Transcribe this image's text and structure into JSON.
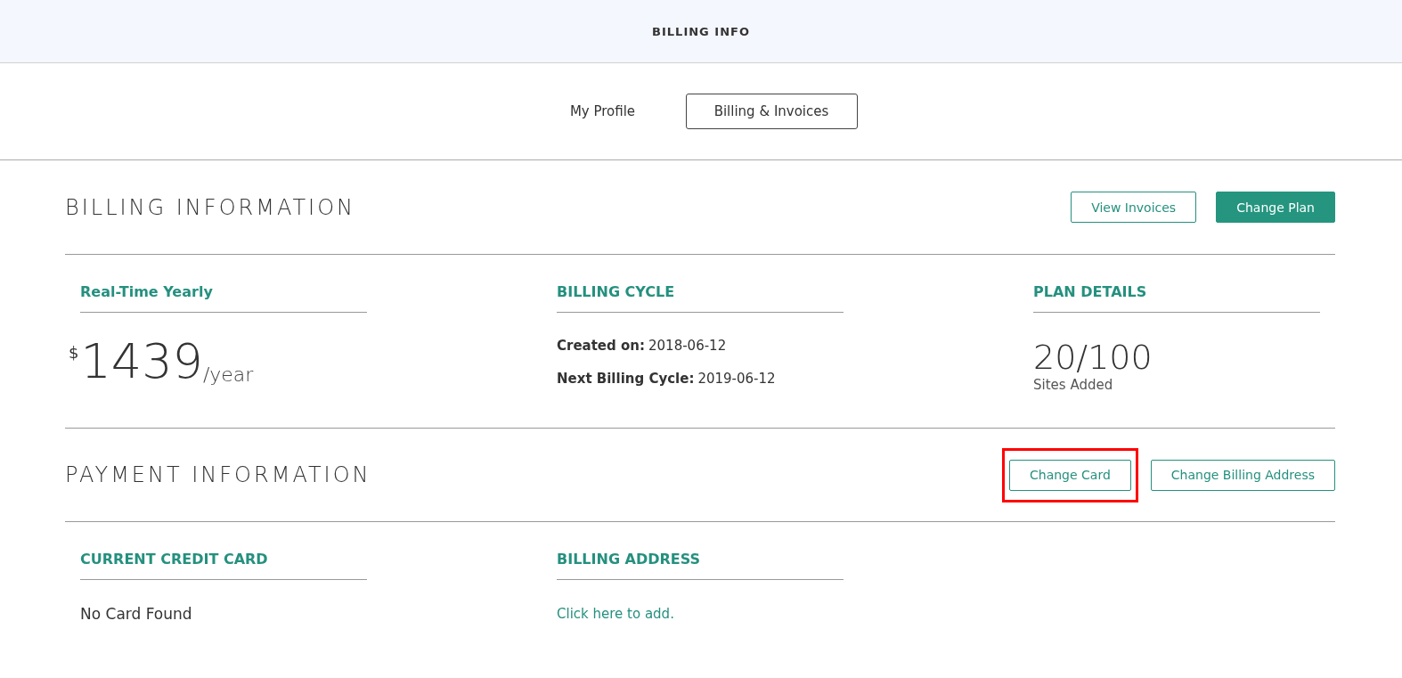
{
  "header": {
    "title": "BILLING INFO"
  },
  "tabs": [
    {
      "label": "My Profile",
      "selected": false
    },
    {
      "label": "Billing & Invoices",
      "selected": true
    }
  ],
  "sections": [
    {
      "title": "BILLING INFORMATION",
      "buttons": [
        {
          "label": "View Invoices",
          "kind": "outline",
          "highlighted": false
        },
        {
          "label": "Change Plan",
          "kind": "filled",
          "highlighted": false
        }
      ],
      "columns": [
        {
          "heading": "Real-Time Yearly",
          "kind": "price",
          "currency": "$",
          "amount": "1439",
          "period": "/year"
        },
        {
          "heading": "BILLING CYCLE",
          "kind": "fields",
          "fields": [
            {
              "label": "Created on:",
              "value": "2018-06-12"
            },
            {
              "label": "Next Billing Cycle:",
              "value": "2019-06-12"
            }
          ]
        },
        {
          "heading": "PLAN DETAILS",
          "kind": "stat",
          "value": "20/100",
          "caption": "Sites Added"
        }
      ]
    },
    {
      "title": "PAYMENT INFORMATION",
      "buttons": [
        {
          "label": "Change Card",
          "kind": "outline",
          "highlighted": true
        },
        {
          "label": "Change Billing Address",
          "kind": "outline",
          "highlighted": false
        }
      ],
      "columns": [
        {
          "heading": "CURRENT CREDIT CARD",
          "kind": "text",
          "text": "No Card Found"
        },
        {
          "heading": "BILLING ADDRESS",
          "kind": "link",
          "text": "Click here to add."
        }
      ]
    }
  ]
}
